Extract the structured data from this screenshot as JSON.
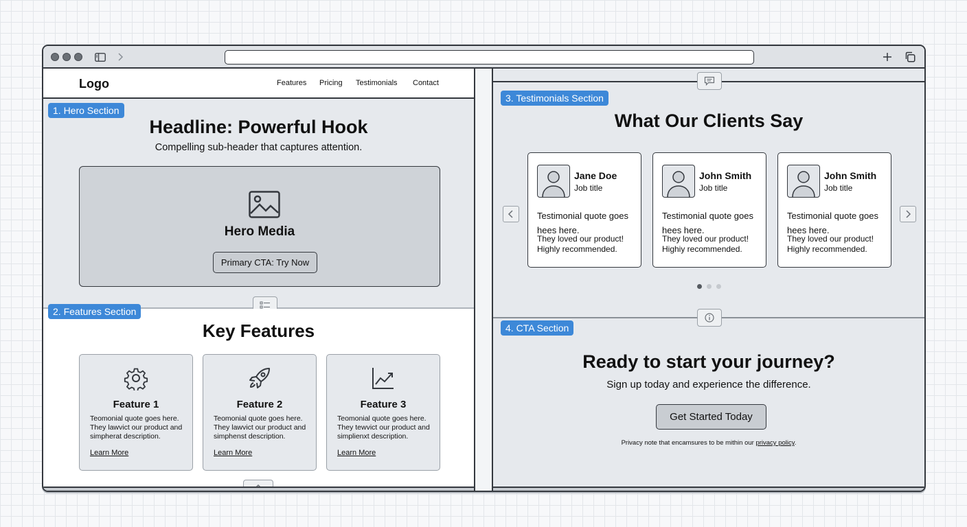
{
  "hero": {
    "tag": "1. Hero Section",
    "headline": "Headline: Powerful Hook",
    "subheader": "Compelling sub-header that captures attention.",
    "media_label": "Hero Media",
    "cta": "Primary CTA: Try Now"
  },
  "nav": {
    "logo": "Logo",
    "links": [
      "Features",
      "Pricing",
      "Testimonials",
      "Contact"
    ]
  },
  "features": {
    "tag": "2. Features Section",
    "title": "Key Features",
    "items": [
      {
        "icon": "gear-icon",
        "title": "Feature 1",
        "desc": "Teomonial quote goes here. They lawvict our product and simpherat description.",
        "link": "Learn More"
      },
      {
        "icon": "rocket-icon",
        "title": "Feature 2",
        "desc": "Teomonial quote goes here. They lawvict our product and simphenst description.",
        "link": "Learn More"
      },
      {
        "icon": "chart-trend-icon",
        "title": "Feature 3",
        "desc": "Teomonial quote goes here. They tewvict our product and simplienxt description.",
        "link": "Learn More"
      }
    ]
  },
  "testimonials": {
    "tag": "3. Testimonials Section",
    "title": "What Our Clients Say",
    "items": [
      {
        "name": "Jane Doe",
        "job": "Job title",
        "quote1": "Testimonial quote goes hees here.",
        "quote2": "They loved our product! Highly recommended."
      },
      {
        "name": "John Smith",
        "job": "Job title",
        "quote1": "Testimonial quote goes hees here.",
        "quote2": "They loved our product! Highiy recommended."
      },
      {
        "name": "John Smith",
        "job": "Job title",
        "quote1": "Testimonial quote goes hees here.",
        "quote2": "They loved our product! Highly recommended."
      }
    ],
    "active_page": 1,
    "page_count": 3
  },
  "cta": {
    "tag": "4. CTA Section",
    "title": "Ready to start your journey?",
    "subtitle": "Sign up today and experience the difference.",
    "button": "Get Started Today",
    "privacy_prefix": "Privacy note that encamsures to be mithin our ",
    "privacy_link": "privacy policy",
    "privacy_suffix": "."
  },
  "colors": {
    "tag_blue": "#3d88d8",
    "outline": "#34383e",
    "panel": "#e6e9ed"
  }
}
